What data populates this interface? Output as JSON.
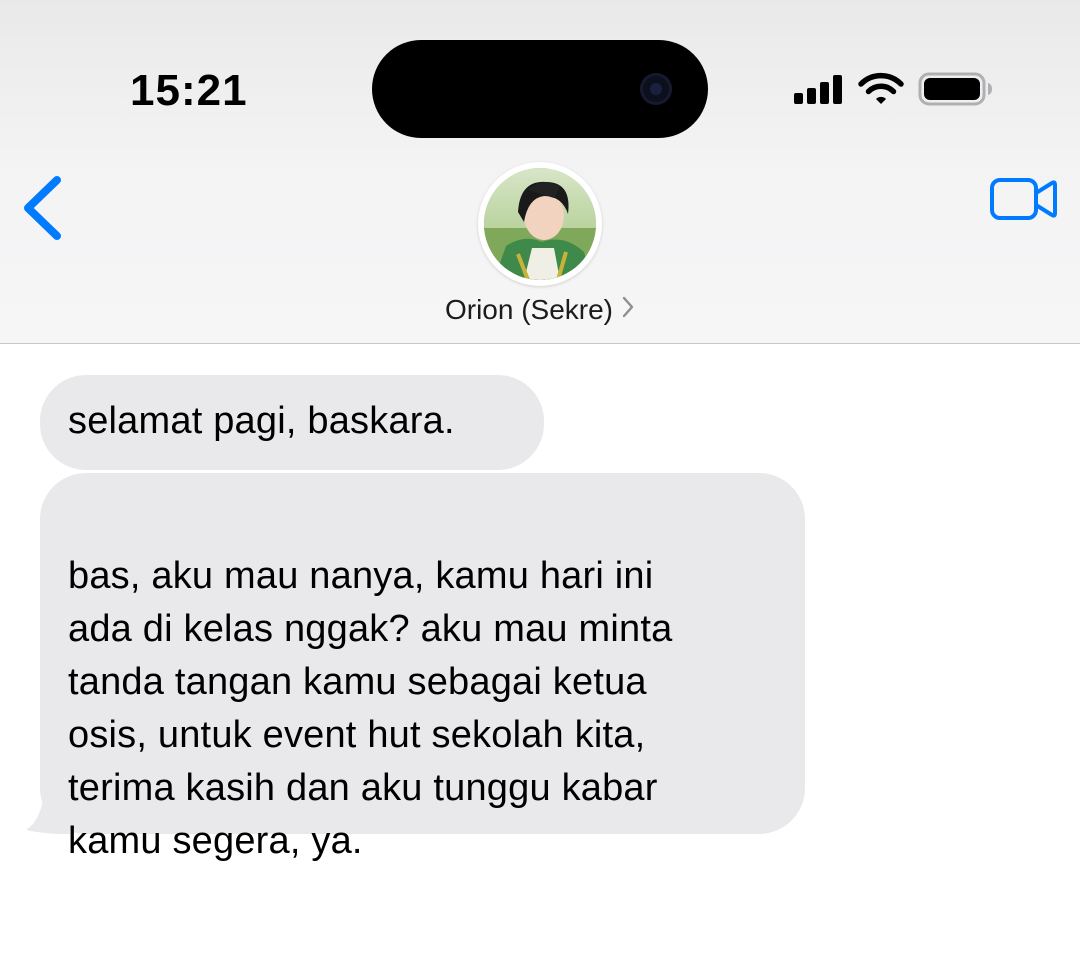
{
  "status_bar": {
    "time": "15:21",
    "signal_bars": 4,
    "wifi_icon": "wifi-icon",
    "battery_icon": "battery-icon"
  },
  "header": {
    "back_icon": "chevron-left-icon",
    "contact_name": "Orion (Sekre)",
    "contact_chevron_icon": "chevron-right-icon",
    "video_icon": "video-camera-icon"
  },
  "messages": [
    {
      "direction": "incoming",
      "text": "selamat pagi, baskara."
    },
    {
      "direction": "incoming",
      "text": "bas, aku mau nanya, kamu hari ini\nada di kelas nggak? aku mau minta\ntanda tangan kamu sebagai ketua\nosis, untuk event hut sekolah kita,\nterima kasih dan aku tunggu kabar\nkamu segera, ya."
    }
  ],
  "colors": {
    "accent": "#007aff",
    "incoming_bubble": "#e9e9eb",
    "header_background": "#f3f3f4"
  }
}
